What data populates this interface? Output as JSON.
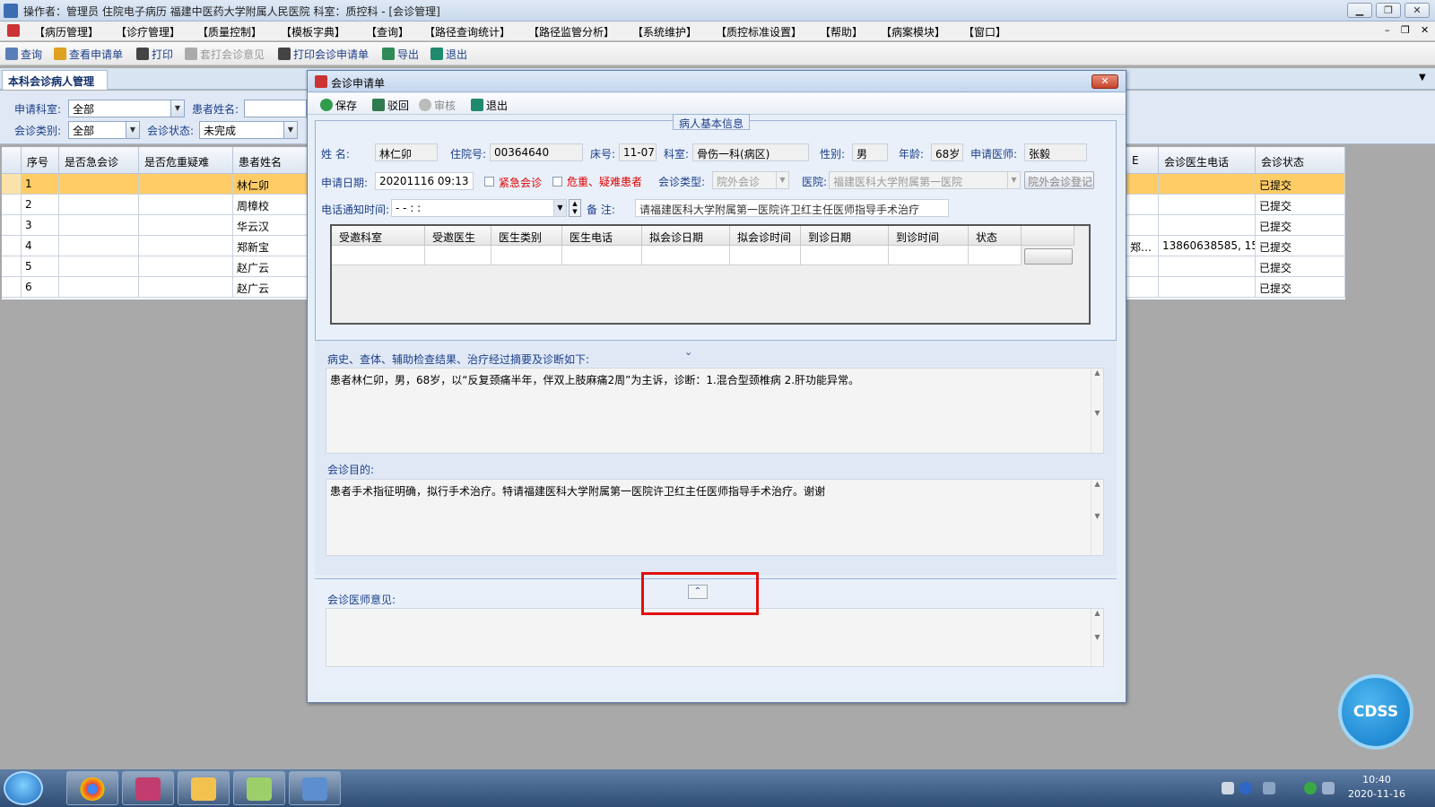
{
  "app": {
    "title": "操作者：管理员 住院电子病历  福建中医药大学附属人民医院  科室：质控科 - [会诊管理]"
  },
  "menu": [
    "【病历管理】",
    "【诊疗管理】",
    "【质量控制】",
    "【模板字典】",
    "【查询】",
    "【路径查询统计】",
    "【路径监管分析】",
    "【系统维护】",
    "【质控标准设置】",
    "【帮助】",
    "【病案模块】",
    "【窗口】"
  ],
  "toolbar": {
    "query": "查询",
    "view_request": "查看申请单",
    "print": "打印",
    "print_opinion": "套打会诊意见",
    "print_request": "打印会诊申请单",
    "export": "导出",
    "exit": "退出"
  },
  "tab": {
    "label": "本科会诊病人管理"
  },
  "filter": {
    "dept_label": "申请科室:",
    "dept_value": "全部",
    "patient_label": "患者姓名:",
    "category_label": "会诊类别:",
    "category_value": "全部",
    "status_label": "会诊状态:",
    "status_value": "未完成"
  },
  "grid": {
    "headers": [
      "序号",
      "是否急会诊",
      "是否危重疑难",
      "患者姓名"
    ],
    "right_headers": [
      "E",
      "会诊医生电话",
      "会诊状态"
    ],
    "rows": [
      {
        "no": "1",
        "name": "林仁卯",
        "frag": "",
        "phone": "",
        "status": "已提交"
      },
      {
        "no": "2",
        "name": "周樟校",
        "frag": "",
        "phone": "",
        "status": "已提交"
      },
      {
        "no": "3",
        "name": "华云汉",
        "frag": "",
        "phone": "",
        "status": "已提交"
      },
      {
        "no": "4",
        "name": "郑新宝",
        "frag": "郑…",
        "phone": "13860638585, 15...",
        "status": "已提交"
      },
      {
        "no": "5",
        "name": "赵广云",
        "frag": "",
        "phone": "",
        "status": "已提交"
      },
      {
        "no": "6",
        "name": "赵广云",
        "frag": "",
        "phone": "",
        "status": "已提交"
      }
    ]
  },
  "dialog": {
    "title": "会诊申请单",
    "close": "✕",
    "toolbar": {
      "save": "保存",
      "reject": "驳回",
      "review": "审核",
      "exit": "退出"
    },
    "section_title": "病人基本信息",
    "patient": {
      "name_label": "姓    名:",
      "name": "林仁卯",
      "inpatient_label": "住院号:",
      "inpatient_no": "00364640",
      "bed_label": "床号:",
      "bed": "11-07",
      "dept_label": "科室:",
      "dept": "骨伤一科(病区)",
      "sex_label": "性别:",
      "sex": "男",
      "age_label": "年龄:",
      "age": "68岁",
      "doctor_label": "申请医师:",
      "doctor": "张毅"
    },
    "request": {
      "date_label": "申请日期:",
      "date": "20201116 09:13",
      "urgent_label": "紧急会诊",
      "critical_label": "危重、疑难患者",
      "type_label": "会诊类型:",
      "type": "院外会诊",
      "hospital_label": "医院:",
      "hospital": "福建医科大学附属第一医院",
      "register_btn": "院外会诊登记",
      "phone_time_label": "电话通知时间:",
      "phone_time": "-    -        :    :",
      "remark_label": "备      注:",
      "remark": "请福建医科大学附属第一医院许卫红主任医师指导手术治疗"
    },
    "invite_table": {
      "headers": [
        "受邀科室",
        "受邀医生",
        "医生类别",
        "医生电话",
        "拟会诊日期",
        "拟会诊时间",
        "到诊日期",
        "到诊时间",
        "状态"
      ]
    },
    "history_label": "病史、查体、辅助检查结果、治疗经过摘要及诊断如下:",
    "history_text": "患者林仁卯，男，68岁，以“反复颈痛半年，伴双上肢麻痛2周”为主诉，诊断：1.混合型颈椎病 2.肝功能异常。",
    "purpose_label": "会诊目的:",
    "purpose_text": "患者手术指征明确，拟行手术治疗。特请福建医科大学附属第一医院许卫红主任医师指导手术治疗。谢谢",
    "opinion_label": "会诊医师意见:",
    "opinion_text": ""
  },
  "cdss": "CDSS",
  "clock": {
    "time": "10:40",
    "date": "2020-11-16"
  }
}
